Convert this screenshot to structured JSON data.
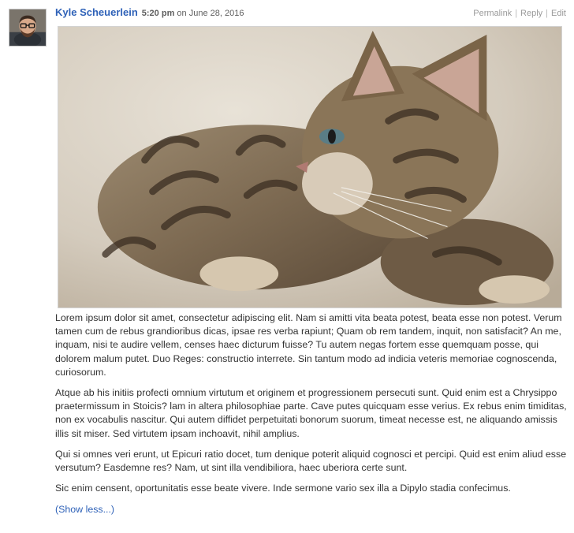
{
  "comment": {
    "author": "Kyle Scheuerlein",
    "time": "5:20 pm",
    "on_word": "on",
    "date": "June 28, 2016",
    "actions": {
      "permalink": "Permalink",
      "separator": "|",
      "reply": "Reply",
      "edit": "Edit"
    },
    "image_icon": "kitten-photo",
    "paragraphs": [
      "Lorem ipsum dolor sit amet, consectetur adipiscing elit. Nam si amitti vita beata potest, beata esse non potest. Verum tamen cum de rebus grandioribus dicas, ipsae res verba rapiunt; Quam ob rem tandem, inquit, non satisfacit? An me, inquam, nisi te audire vellem, censes haec dicturum fuisse? Tu autem negas fortem esse quemquam posse, qui dolorem malum putet. Duo Reges: constructio interrete. Sin tantum modo ad indicia veteris memoriae cognoscenda, curiosorum.",
      "Atque ab his initiis profecti omnium virtutum et originem et progressionem persecuti sunt. Quid enim est a Chrysippo praetermissum in Stoicis? lam in altera philosophiae parte. Cave putes quicquam esse verius. Ex rebus enim timiditas, non ex vocabulis nascitur. Qui autem diffidet perpetuitati bonorum suorum, timeat necesse est, ne aliquando amissis illis sit miser. Sed virtutem ipsam inchoavit, nihil amplius.",
      "Qui si omnes veri erunt, ut Epicuri ratio docet, tum denique poterit aliquid cognosci et percipi. Quid est enim aliud esse versutum? Easdemne res? Nam, ut sint illa vendibiliora, haec uberiora certe sunt.",
      "Sic enim censent, oportunitatis esse beate vivere. Inde sermone vario sex illa a Dipylo stadia confecimus."
    ],
    "show_less": "(Show less...)"
  },
  "colors": {
    "author_link": "#2f62b8",
    "action_link": "#9a9a9a",
    "text": "#333333"
  }
}
